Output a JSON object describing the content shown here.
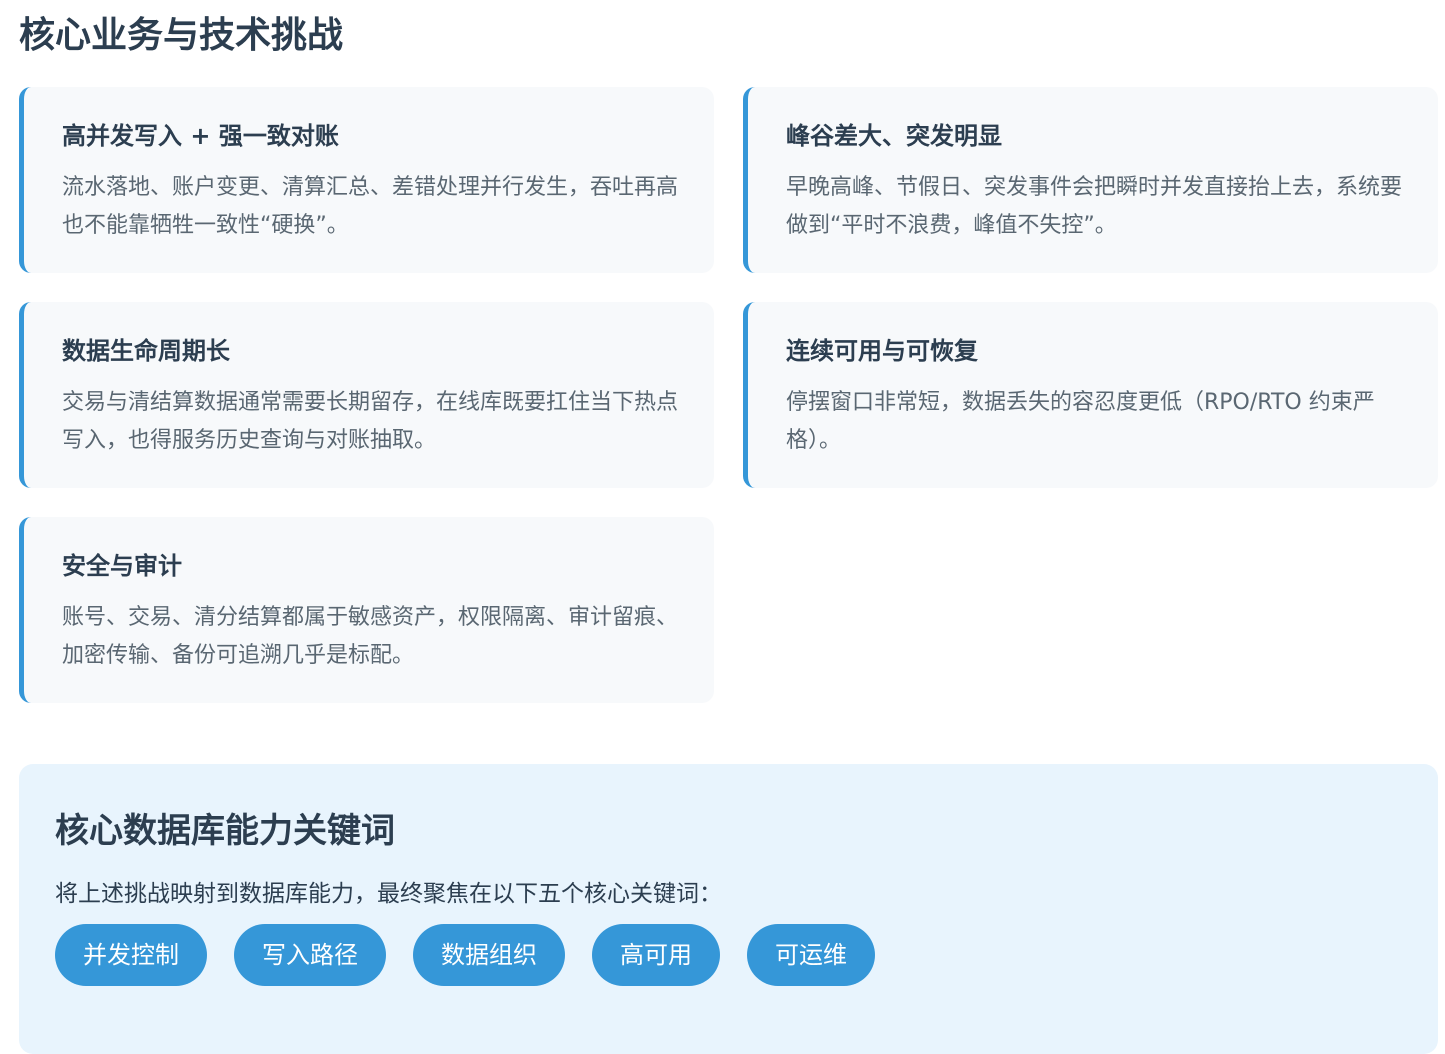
{
  "page": {
    "title": "核心业务与技术挑战"
  },
  "challenges": [
    {
      "title": "高并发写入 + 强一致对账",
      "desc": "流水落地、账户变更、清算汇总、差错处理并行发生，吞吐再高也不能靠牺牲一致性“硬换”。"
    },
    {
      "title": "峰谷差大、突发明显",
      "desc": "早晚高峰、节假日、突发事件会把瞬时并发直接抬上去，系统要做到“平时不浪费，峰值不失控”。"
    },
    {
      "title": "数据生命周期长",
      "desc": "交易与清结算数据通常需要长期留存，在线库既要扛住当下热点写入，也得服务历史查询与对账抽取。"
    },
    {
      "title": "连续可用与可恢复",
      "desc": "停摆窗口非常短，数据丢失的容忍度更低（RPO/RTO 约束严格）。"
    },
    {
      "title": "安全与审计",
      "desc": "账号、交易、清分结算都属于敏感资产，权限隔离、审计留痕、加密传输、备份可追溯几乎是标配。"
    }
  ],
  "keywords": {
    "title": "核心数据库能力关键词",
    "intro": "将上述挑战映射到数据库能力，最终聚焦在以下五个核心关键词：",
    "tags": [
      "并发控制",
      "写入路径",
      "数据组织",
      "高可用",
      "可运维"
    ]
  },
  "colors": {
    "accent": "#3597d8",
    "card_bg": "#f7f9fb",
    "panel_bg": "#e8f4fd",
    "heading": "#2c3e50",
    "body_text": "#5a6772"
  }
}
